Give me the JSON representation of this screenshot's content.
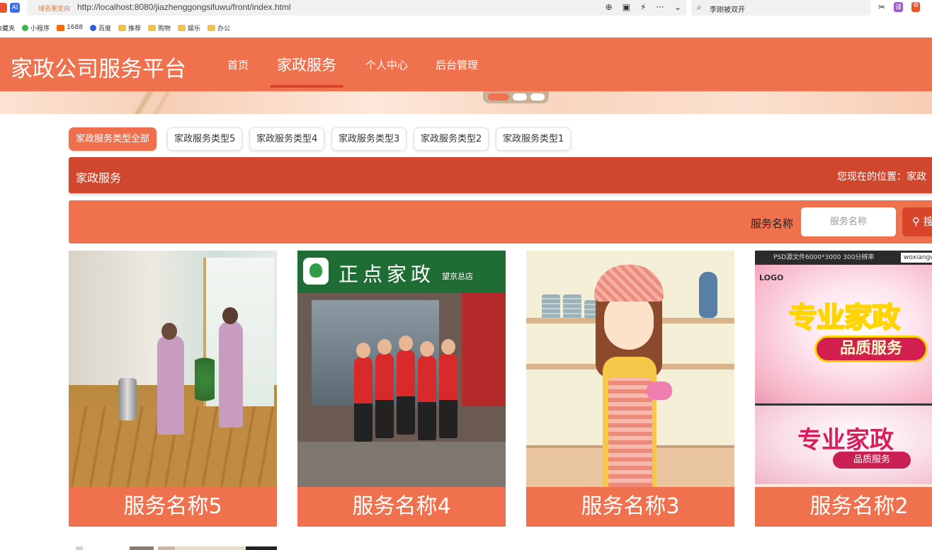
{
  "browser": {
    "redirect_label": "域名重定向",
    "url": "http://localhost:8080/jiazhenggongsifuwu/front/index.html",
    "search_text": "李刚被双开",
    "tools": [
      "⊕",
      "▣",
      "⚡",
      "···",
      "⌄"
    ],
    "right_tools": [
      "✂",
      "译",
      "⚙"
    ]
  },
  "bookmarks": [
    {
      "label": "收藏夹",
      "icon": "bookmark-icon"
    },
    {
      "label": "小程序",
      "icon": "miniprogram-icon"
    },
    {
      "label": "1688",
      "icon": "1688-icon"
    },
    {
      "label": "百度",
      "icon": "baidu-icon"
    },
    {
      "label": "推荐",
      "icon": "folder-icon"
    },
    {
      "label": "购物",
      "icon": "folder-icon"
    },
    {
      "label": "娱乐",
      "icon": "folder-icon"
    },
    {
      "label": "办公",
      "icon": "folder-icon"
    }
  ],
  "site": {
    "logo": "家政公司服务平台",
    "nav": [
      {
        "label": "首页",
        "active": false
      },
      {
        "label": "家政服务",
        "active": true
      },
      {
        "label": "个人中心",
        "active": false
      },
      {
        "label": "后台管理",
        "active": false
      }
    ],
    "colors": {
      "primary": "#f0714d",
      "dark": "#d0472d",
      "accent": "#d9452b"
    }
  },
  "banner": {
    "dots": 3,
    "active_dot": 0
  },
  "categories": [
    {
      "label": "家政服务类型全部",
      "active": true
    },
    {
      "label": "家政服务类型5",
      "active": false
    },
    {
      "label": "家政服务类型4",
      "active": false
    },
    {
      "label": "家政服务类型3",
      "active": false
    },
    {
      "label": "家政服务类型2",
      "active": false
    },
    {
      "label": "家政服务类型1",
      "active": false
    }
  ],
  "breadcrumb": {
    "title": "家政服务",
    "location_prefix": "您现在的位置：家政"
  },
  "search": {
    "label": "服务名称",
    "placeholder": "服务名称",
    "button_icon": "search-icon",
    "button_label": "搜"
  },
  "cards": [
    {
      "title": "服务名称5"
    },
    {
      "title": "服务名称4"
    },
    {
      "title": "服务名称3"
    },
    {
      "title": "服务名称2"
    }
  ],
  "poster": {
    "strip_text": "PSD源文件6000*3000  300分辨率",
    "watermark": "woxiangwo",
    "logo": "LOGO",
    "headline": "专业家政",
    "badge": "品质服务",
    "headline2": "专业家政",
    "badge2": "品质服务"
  },
  "storefront": {
    "sign": "正点家政",
    "sub": "望京总店"
  }
}
